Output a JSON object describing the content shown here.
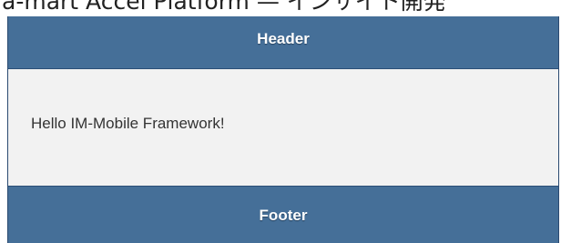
{
  "caption": {
    "text": "a-mart Accel Platform — インサイト開発"
  },
  "header": {
    "title": "Header"
  },
  "content": {
    "text": "Hello IM-Mobile Framework!"
  },
  "footer": {
    "title": "Footer"
  },
  "colors": {
    "bar_background": "#456f98",
    "content_background": "#f2f2f2",
    "bar_text": "#ffffff",
    "content_text": "#333333"
  }
}
